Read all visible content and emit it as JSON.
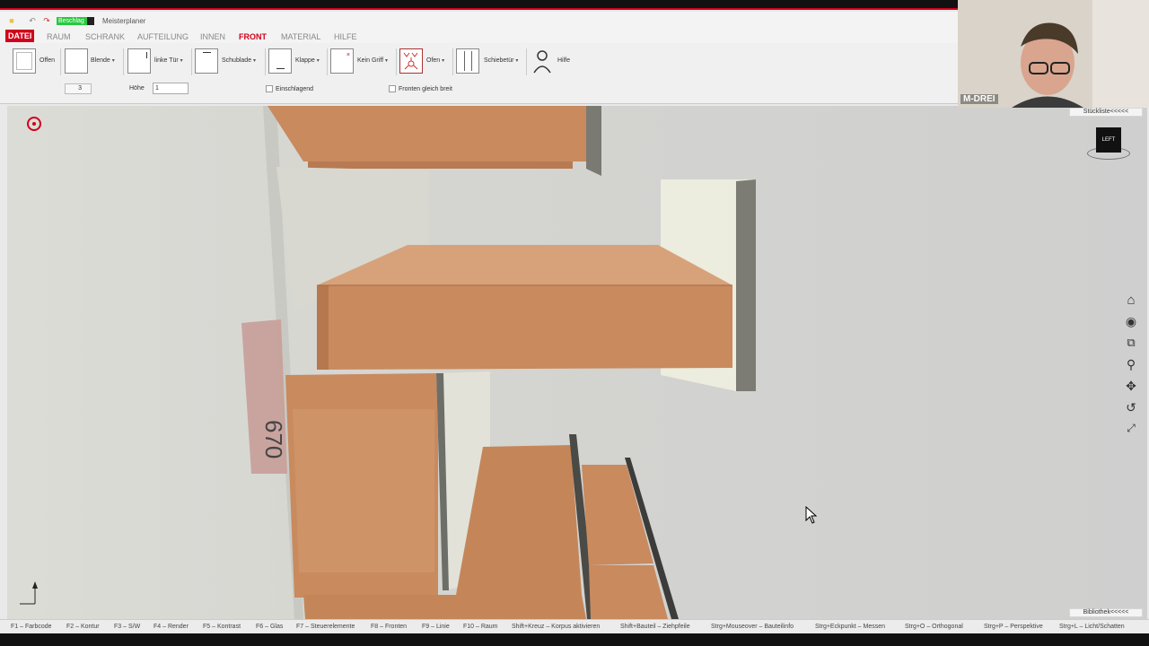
{
  "app": {
    "title": "Meisterplaner",
    "quick_field": "Beschlag"
  },
  "menu": {
    "items": [
      "DATEI",
      "RAUM",
      "SCHRANK",
      "AUFTEILUNG",
      "INNEN",
      "FRONT",
      "MATERIAL",
      "HILFE"
    ],
    "active": "FRONT"
  },
  "ribbon": {
    "buttons": [
      {
        "label": "Offen",
        "icon": "open-front-icon",
        "dropdown": false
      },
      {
        "label": "Blende",
        "icon": "panel-icon",
        "dropdown": true
      },
      {
        "label": "linke Tür",
        "icon": "left-door-icon",
        "dropdown": true
      },
      {
        "label": "Schublade",
        "icon": "drawer-icon",
        "dropdown": true
      },
      {
        "label": "Klappe",
        "icon": "flap-icon",
        "dropdown": true
      },
      {
        "label": "Kein Griff",
        "icon": "no-handle-icon",
        "dropdown": true
      },
      {
        "label": "Ofen",
        "icon": "oven-icon",
        "dropdown": true
      },
      {
        "label": "Schiebetür",
        "icon": "sliding-door-icon",
        "dropdown": true
      },
      {
        "label": "Hilfe",
        "icon": "help-person-icon",
        "dropdown": false
      }
    ],
    "count_value": "3",
    "height_label": "Höhe",
    "height_value": "1",
    "einschlagend_label": "Einschlagend",
    "fronten_label": "Fronten gleich breit"
  },
  "viewport": {
    "dimension_label": "670",
    "view_cube_label": "LEFT",
    "stueckliste_label": "Stückliste<<<<<",
    "bibliothek_label": "Bibliothek<<<<<"
  },
  "webcam": {
    "name": "M-DREI"
  },
  "status_shortcuts": [
    "F1 – Farbcode",
    "F2 – Kontur",
    "F3 – S/W",
    "F4 – Render",
    "F5 – Kontrast",
    "F6 – Glas",
    "F7 – Steuerelemente",
    "F8 – Fronten",
    "F9 – Linie",
    "F10 – Raum",
    "Shift+Kreuz – Korpus aktivieren",
    "Shift+Bauteil – Ziehpfeile",
    "Strg+Mouseover – Bauteilinfo",
    "Strg+Eckpunkt – Messen",
    "Strg+O – Orthogonal",
    "Strg+P – Perspektive",
    "Strg+L – Licht/Schatten"
  ],
  "colors": {
    "accent": "#d0021b",
    "wood": "#c98a5e",
    "panel": "#e8e8e0",
    "background": "#d2d2d0"
  }
}
